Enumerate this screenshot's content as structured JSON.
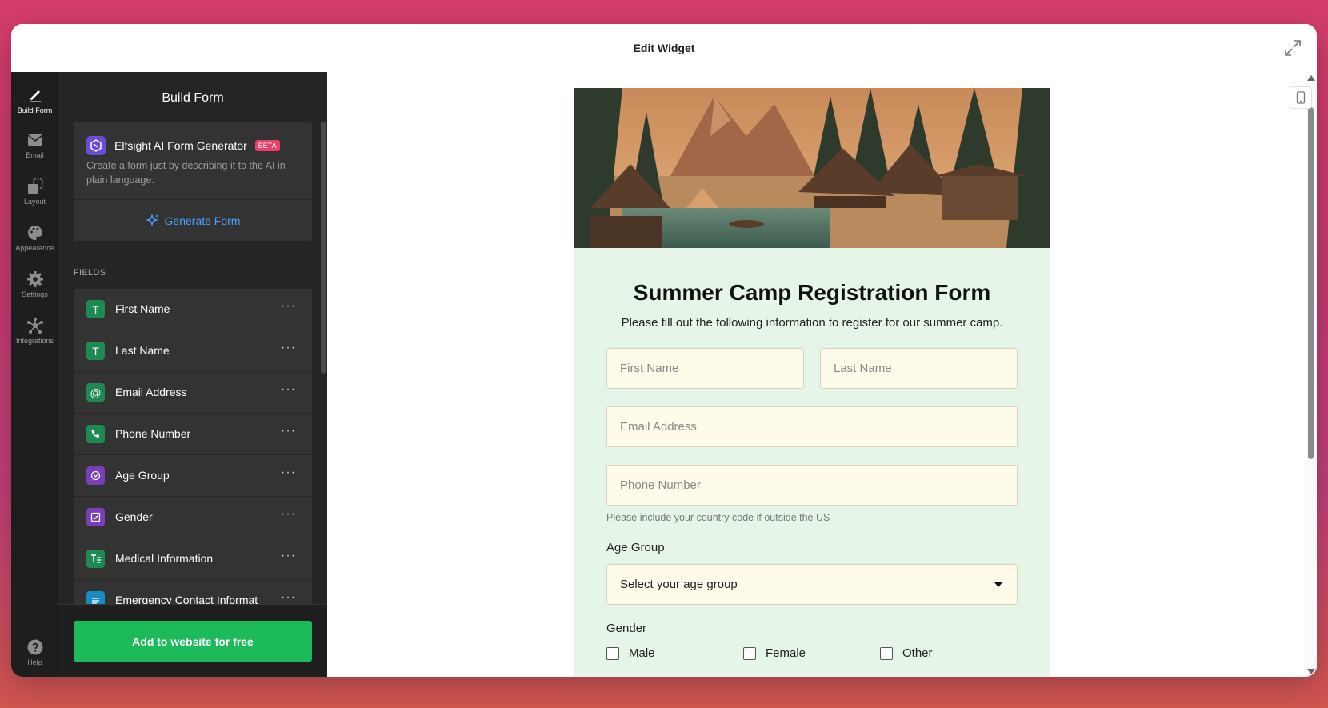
{
  "window": {
    "title": "Edit Widget",
    "expand_icon": "expand-icon"
  },
  "rail": {
    "items": [
      {
        "label": "Build Form",
        "icon": "pencil-icon",
        "active": true
      },
      {
        "label": "Email",
        "icon": "envelope-icon"
      },
      {
        "label": "Layout",
        "icon": "layout-icon"
      },
      {
        "label": "Appearance",
        "icon": "palette-icon"
      },
      {
        "label": "Settings",
        "icon": "gear-icon"
      },
      {
        "label": "Integrations",
        "icon": "integrations-icon"
      }
    ],
    "help": {
      "label": "Help",
      "icon": "help-icon"
    }
  },
  "panel": {
    "title": "Build Form",
    "ai": {
      "name": "Elfsight AI Form Generator",
      "badge": "BETA",
      "description": "Create a form just by describing it to the AI in plain language.",
      "button": "Generate Form"
    },
    "fields_label": "FIELDS",
    "fields": [
      {
        "name": "First Name",
        "icon": "text-icon",
        "color": "#1e8a52"
      },
      {
        "name": "Last Name",
        "icon": "text-icon",
        "color": "#1e8a52"
      },
      {
        "name": "Email Address",
        "icon": "at-icon",
        "color": "#1e8a52"
      },
      {
        "name": "Phone Number",
        "icon": "phone-icon",
        "color": "#1e8a52"
      },
      {
        "name": "Age Group",
        "icon": "dropdown-icon",
        "color": "#7a3fb8"
      },
      {
        "name": "Gender",
        "icon": "checkbox-icon",
        "color": "#7a3fb8"
      },
      {
        "name": "Medical Information",
        "icon": "paragraph-icon",
        "color": "#1e8a52"
      },
      {
        "name": "Emergency Contact Informat",
        "icon": "heading-icon",
        "color": "#178cc2"
      }
    ],
    "add_button": "Add to website for free"
  },
  "form": {
    "title": "Summer Camp Registration Form",
    "subtitle": "Please fill out the following information to register for our summer camp.",
    "first_name_placeholder": "First Name",
    "last_name_placeholder": "Last Name",
    "email_placeholder": "Email Address",
    "phone_placeholder": "Phone Number",
    "phone_hint": "Please include your country code if outside the US",
    "age_label": "Age Group",
    "age_select": "Select your age group",
    "gender_label": "Gender",
    "gender_options": [
      "Male",
      "Female",
      "Other"
    ]
  },
  "colors": {
    "accent_green": "#1dba5a",
    "link_blue": "#4aa3ff",
    "form_bg": "#e5f6e8",
    "input_bg": "#fefbea"
  }
}
